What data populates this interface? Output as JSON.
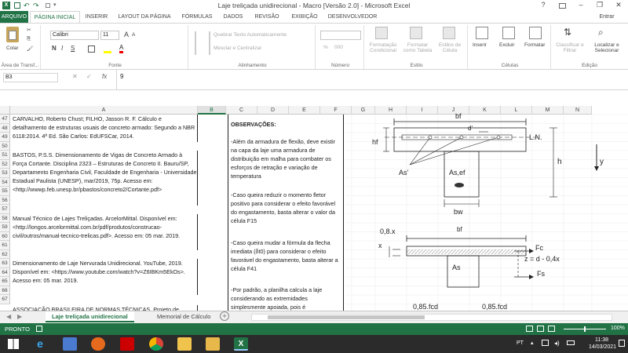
{
  "window": {
    "title": "Laje treliçada unidirecional - Macro [Versão 2.0] - Microsoft Excel",
    "help": "?",
    "minimize": "–",
    "restore": "❐",
    "close": "✕",
    "signin": "Entrar"
  },
  "quick_access": {
    "undo": "↶",
    "redo": "↷",
    "more": "▾"
  },
  "tabs": [
    "ARQUIVO",
    "PÁGINA INICIAL",
    "INSERIR",
    "LAYOUT DA PÁGINA",
    "FÓRMULAS",
    "DADOS",
    "REVISÃO",
    "EXIBIÇÃO",
    "DESENVOLVEDOR"
  ],
  "ribbon": {
    "clipboard": {
      "paste": "Colar",
      "label": "Área de Transf..."
    },
    "font": {
      "name": "Calibri",
      "size": "11",
      "bold": "N",
      "italic": "I",
      "underline": "S",
      "grow": "A",
      "shrink": "A",
      "label": "Fonte"
    },
    "alignment": {
      "wrap": "Quebrar Texto Automaticamente",
      "merge": "Mesclar e Centralizar",
      "label": "Alinhamento"
    },
    "number": {
      "format": "",
      "percent": "%",
      "thousands": "000",
      "label": "Número"
    },
    "styles": {
      "conditional": "Formatação Condicional",
      "as_table": "Formatar como Tabela",
      "cell_styles": "Estilos de Célula",
      "label": "Estilo"
    },
    "cells": {
      "insert": "Inserir",
      "delete": "Excluir",
      "format": "Formatar",
      "label": "Células"
    },
    "editing": {
      "sort": "Classificar e Filtrar",
      "find": "Localizar e Selecionar",
      "label": "Edição"
    }
  },
  "formula_bar": {
    "name_box": "B3",
    "fx": "fx",
    "value": "9"
  },
  "columns": [
    "A",
    "B",
    "C",
    "D",
    "E",
    "F",
    "G",
    "H",
    "I",
    "J",
    "K",
    "L",
    "M",
    "N"
  ],
  "rows": [
    "47",
    "48",
    "49",
    "50",
    "51",
    "52",
    "53",
    "54",
    "55",
    "56",
    "57",
    "58",
    "59",
    "60",
    "61",
    "62",
    "63",
    "64",
    "65",
    "66",
    "67"
  ],
  "references": [
    "CARVALHO, Roberto Chust; FILHO, Jasson R. F. Cálculo e detalhamento de estruturas usuais de concreto armado: Segundo a NBR 6118:2014. 4ª Ed. São Carlos: EdUFSCar, 2014.",
    "BASTOS, P.S.S. Dimensionamento de Vigas de Concreto Armado à Força Cortante. Disciplina 2323 – Estruturas de Concreto II. Bauru/SP, Departamento Engenharia Civil, Faculdade de Engenharia - Universidade Estadual Paulista (UNESP), mar/2019, 75p. Acesso em: <http://wwwp.feb.unesp.br/pbastos/concreto2/Cortante.pdf>",
    "Manual Técnico de Lajes Treliçadas. ArcelorMittal. Disponível em: <http://longos.arcelormittal.com.br/pdf/produtos/construcao-civil/outros/manual-tecnico-trelicas.pdf>. Acesso em: 05 mar. 2019.",
    "Dimensionamento de Laje Nervurada Unidirecional. YouTube, 2019. Disponível em: <https://www.youtube.com/watch?v=Z6IBKm5EkOs>. Acesso em: 05 mar. 2019.",
    "ASSOCIAÇÃO BRASILEIRA DE NORMAS TÉCNICAS. Projeto de"
  ],
  "observations": {
    "title": "OBSERVAÇÕES:",
    "items": [
      "-Além da armadura de flexão, deve existir na capa da laje uma armadura de distribuição em malha para combater os esforços de retração e variação de temperatura",
      "-Caso queira reduzir o momento fletor positivo para considerar o efeito favorável do engastamento, basta alterar o valor da célula F15",
      "-Caso queira mudar a fórmula da flecha imediata (δt0) para considerar o efeito favorável do engastamento, basta alterar a célula F41",
      "-Por padrão, a planilha calcula a laje considerando as extremidades simplesmente apoiada, pois é"
    ]
  },
  "diagram": {
    "bf": "bf",
    "dprime": "d'",
    "hf": "hf",
    "ln": "L.N.",
    "h": "h",
    "y": "y",
    "as_prime": "As'",
    "as_ef": "As,ef",
    "bw": "bw",
    "x08": "0,8.x",
    "x": "x",
    "fc": "Fc",
    "z": "z = d - 0,4x",
    "as": "As",
    "fs": "Fs",
    "fcd1": "0,85.fcd",
    "fcd2": "0,85.fcd"
  },
  "sheets": {
    "active": "Laje treliçada unidirecional",
    "other": "Memorial de Cálculo",
    "add": "+"
  },
  "status": {
    "ready": "PRONTO",
    "zoom": "100%"
  },
  "taskbar": {
    "lang": "PT",
    "time": "11:38",
    "date": "14/03/2021"
  }
}
